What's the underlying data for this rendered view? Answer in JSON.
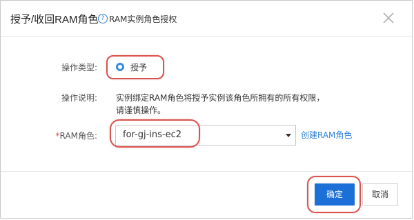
{
  "header": {
    "title": "授予/收回RAM角色",
    "help_icon_glyph": "?",
    "help_link": "RAM实例角色授权"
  },
  "form": {
    "operation_type": {
      "label": "操作类型:",
      "selected_option": "授予"
    },
    "operation_desc": {
      "label": "操作说明:",
      "line1": "实例绑定RAM角色将授予实例该角色所拥有的所有权限，",
      "line2": "请谨慎操作。"
    },
    "ram_role": {
      "required_mark": "*",
      "label": "RAM角色:",
      "value": "for-gj-ins-ec2",
      "create_link": "创建RAM角色"
    }
  },
  "footer": {
    "ok_label": "确定",
    "cancel_label": "取消"
  },
  "colors": {
    "primary": "#1b6fd6",
    "link": "#2e7fd8",
    "highlight": "#d9534f",
    "required": "#d9534f"
  },
  "icons": {
    "help": "question-circle-icon",
    "close": "close-icon",
    "dropdown": "caret-down-icon",
    "radio": "radio-checked-icon"
  }
}
